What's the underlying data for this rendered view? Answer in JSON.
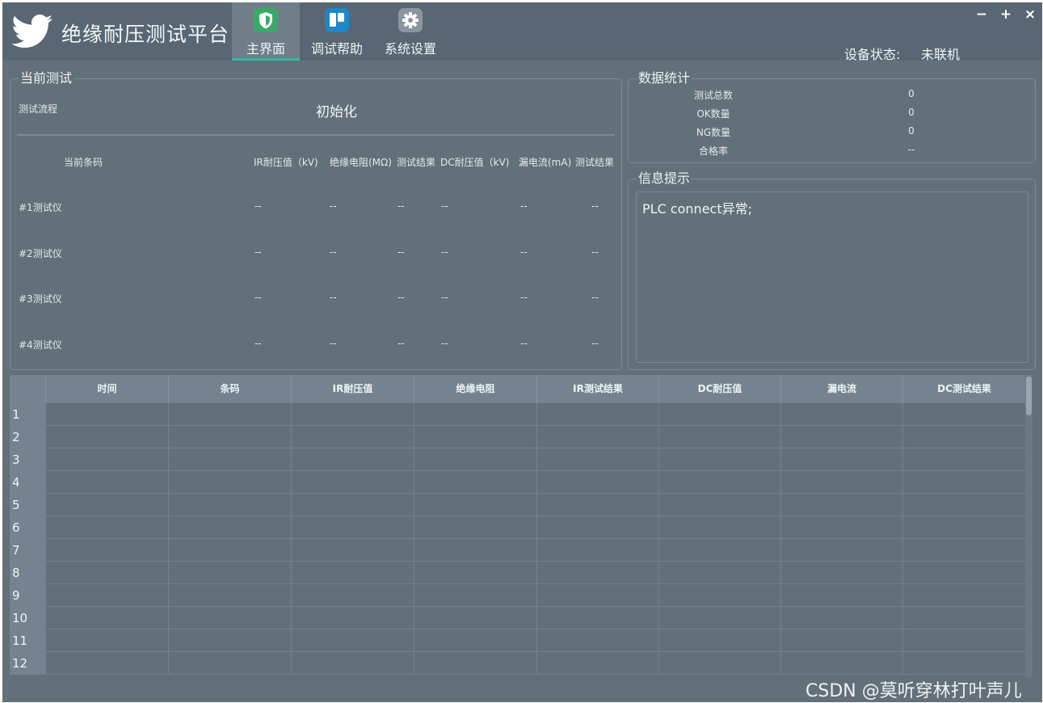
{
  "app": {
    "title": "绝缘耐压测试平台",
    "brand_color": "#2bbba6"
  },
  "nav": {
    "tabs": [
      {
        "label": "主界面",
        "icon": "shield-icon",
        "active": true,
        "icon_color": "#3aa866"
      },
      {
        "label": "调试帮助",
        "icon": "board-icon",
        "active": false,
        "icon_color": "#1e87c7"
      },
      {
        "label": "系统设置",
        "icon": "gear-icon",
        "active": false,
        "icon_color": "#8a969e"
      }
    ]
  },
  "window_controls": {
    "minimize": "−",
    "maximize": "+",
    "close": "×"
  },
  "device_status": {
    "label": "设备状态:",
    "value": "未联机"
  },
  "current_test": {
    "title": "当前测试",
    "flow_label": "测试流程",
    "flow_value": "初始化",
    "columns": {
      "barcode": "当前条码",
      "ir_voltage": "IR耐压值（kV)",
      "insulation": "绝缘电阻(MΩ)",
      "ir_result": "测试结果",
      "dc_voltage": "DC耐压值（kV)",
      "leakage": "漏电流(mA)",
      "dc_result": "测试结果"
    },
    "testers": [
      {
        "name": "#1测试仪",
        "ir": "--",
        "res": "--",
        "r1": "--",
        "dc": "--",
        "leak": "--",
        "r2": "--"
      },
      {
        "name": "#2测试仪",
        "ir": "--",
        "res": "--",
        "r1": "--",
        "dc": "--",
        "leak": "--",
        "r2": "--"
      },
      {
        "name": "#3测试仪",
        "ir": "--",
        "res": "--",
        "r1": "--",
        "dc": "--",
        "leak": "--",
        "r2": "--"
      },
      {
        "name": "#4测试仪",
        "ir": "--",
        "res": "--",
        "r1": "--",
        "dc": "--",
        "leak": "--",
        "r2": "--"
      }
    ]
  },
  "stats": {
    "title": "数据统计",
    "items": [
      {
        "label": "测试总数",
        "value": "0"
      },
      {
        "label": "OK数量",
        "value": "0"
      },
      {
        "label": "NG数量",
        "value": "0"
      },
      {
        "label": "合格率",
        "value": "--"
      }
    ]
  },
  "info": {
    "title": "信息提示",
    "message": "PLC connect异常;"
  },
  "grid": {
    "columns": [
      "时间",
      "条码",
      "IR耐压值",
      "绝缘电阻",
      "IR测试结果",
      "DC耐压值",
      "漏电流",
      "DC测试结果"
    ],
    "rows": [
      "1",
      "2",
      "3",
      "4",
      "5",
      "6",
      "7",
      "8",
      "9",
      "10",
      "11",
      "12"
    ]
  },
  "watermark": "CSDN @莫听穿林打叶声儿"
}
